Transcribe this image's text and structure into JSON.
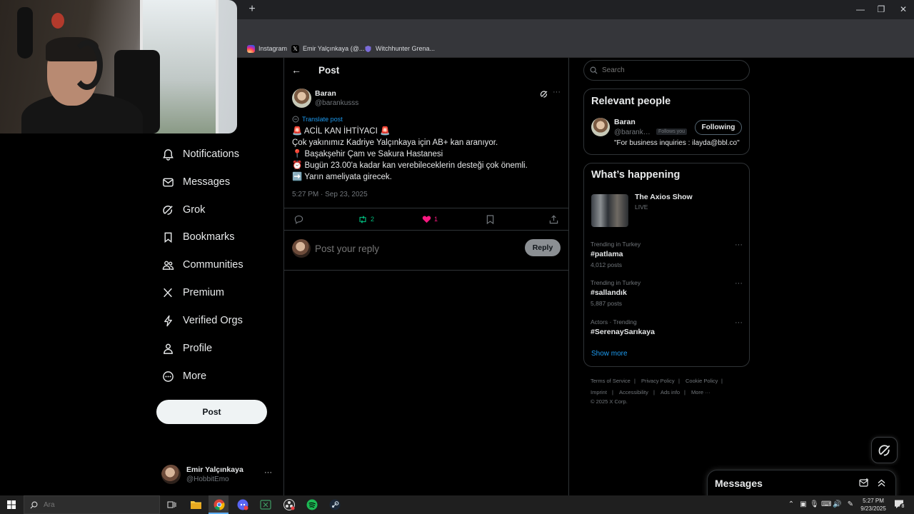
{
  "browser": {
    "new_tab_symbol": "+",
    "window_controls": {
      "minimize": "—",
      "restore": "❐",
      "close": "✕"
    },
    "toolbar_icons": [
      "install-icon",
      "translate-icon",
      "star-icon",
      "extensions-icon",
      "media-icon",
      "profile-icon",
      "menu-icon"
    ],
    "bookmarks": [
      {
        "label": "Instagram",
        "icon": "instagram-icon",
        "color": "#e1306c"
      },
      {
        "label": "Emir Yalçınkaya (@...",
        "icon": "x-logo-icon",
        "color": "#000000"
      },
      {
        "label": "Witchhunter Grena...",
        "icon": "shield-icon",
        "color": "#7b6cd9"
      }
    ]
  },
  "sidebar": {
    "items": [
      {
        "label": "Notifications",
        "icon": "bell-icon"
      },
      {
        "label": "Messages",
        "icon": "envelope-icon"
      },
      {
        "label": "Grok",
        "icon": "grok-icon"
      },
      {
        "label": "Bookmarks",
        "icon": "bookmark-icon"
      },
      {
        "label": "Communities",
        "icon": "people-icon"
      },
      {
        "label": "Premium",
        "icon": "x-logo-icon"
      },
      {
        "label": "Verified Orgs",
        "icon": "lightning-icon"
      },
      {
        "label": "Profile",
        "icon": "person-icon"
      },
      {
        "label": "More",
        "icon": "more-circle-icon"
      }
    ],
    "post_button": "Post",
    "account": {
      "name": "Emir Yalçınkaya",
      "handle": "@HobbitEmo",
      "more": "···"
    }
  },
  "main": {
    "header": {
      "title": "Post",
      "back": "←"
    },
    "tweet": {
      "author_name": "Baran",
      "author_handle": "@barankusss",
      "more": "···",
      "translate": "Translate post",
      "lines": [
        "🚨 ACİL KAN İHTİYACI 🚨",
        "Çok yakınımız Kadriye Yalçınkaya için AB+ kan aranıyor.",
        "📍 Başakşehir Çam ve Sakura Hastanesi",
        "⏰ Bugün 23.00'a kadar kan verebileceklerin desteği çok önemli.",
        "➡️ Yarın ameliyata girecek."
      ],
      "timestamp": "5:27 PM · Sep 23, 2025",
      "actions": {
        "reply_count": "",
        "retweet_count": "2",
        "like_count": "1",
        "retweet_color": "#00ba7c",
        "like_color": "#f91880"
      }
    },
    "reply_box": {
      "placeholder": "Post your reply",
      "button": "Reply"
    }
  },
  "right": {
    "search": {
      "placeholder": "Search"
    },
    "relevant": {
      "title": "Relevant people",
      "person": {
        "name": "Baran",
        "handle": "@barankusss",
        "follows_you": "Follows you",
        "button": "Following",
        "bio": "\"For business inquiries : ilayda@bbl.co\""
      }
    },
    "happening": {
      "title": "What’s happening",
      "show": {
        "title": "The Axios Show",
        "status": "LIVE"
      },
      "trends": [
        {
          "meta": "Trending in Turkey",
          "name": "#patlama",
          "count": "4,012 posts"
        },
        {
          "meta": "Trending in Turkey",
          "name": "#sallandık",
          "count": "5,887 posts"
        },
        {
          "meta": "Actors · Trending",
          "name": "#SerenaySarıkaya",
          "count": ""
        }
      ],
      "show_more": "Show more"
    },
    "footer": {
      "row1": [
        "Terms of Service",
        "Privacy Policy",
        "Cookie Policy"
      ],
      "row2": [
        "Imprint",
        "Accessibility",
        "Ads info",
        "More ···"
      ],
      "copyright": "© 2025 X Corp."
    },
    "messages_drawer": {
      "title": "Messages"
    }
  },
  "taskbar": {
    "search_placeholder": "Ara",
    "time": "5:27 PM",
    "date": "9/23/2025",
    "notification_count": "8"
  },
  "colors": {
    "link_blue": "#1d9bf0",
    "muted": "#71767b",
    "border": "#2f3336"
  }
}
